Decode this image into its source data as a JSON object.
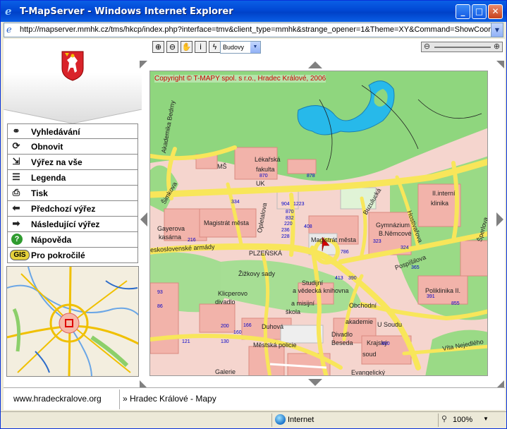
{
  "window": {
    "title": "T-MapServer - Windows Internet Explorer",
    "url": "http://mapserver.mmhk.cz/tms/hkcp/index.php?interface=tmv&client_type=mmhk&strange_opener=1&Theme=XY&Command=ShowCoor"
  },
  "sidebar": {
    "items": [
      {
        "label": "Vyhledávání",
        "icon": "binoculars-icon"
      },
      {
        "label": "Obnovit",
        "icon": "refresh-icon"
      },
      {
        "label": "Výřez na vše",
        "icon": "zoom-all-icon"
      },
      {
        "label": "Legenda",
        "icon": "legend-icon"
      },
      {
        "label": "Tisk",
        "icon": "print-icon"
      },
      {
        "label": "Předchozí výřez",
        "icon": "arrow-left-icon"
      },
      {
        "label": "Následující výřez",
        "icon": "arrow-right-icon"
      },
      {
        "label": "Nápověda",
        "icon": "help-icon"
      },
      {
        "label": "Pro pokročilé",
        "icon": "gis-icon",
        "badge": "GIS"
      }
    ]
  },
  "toolbar": {
    "layer": "Budovy"
  },
  "map": {
    "copyright": "Copyright © T-MAPY spol. s r.o., Hradec Králové, 2006",
    "labels": {
      "akademika_bedrny": "Akademika Bedrny",
      "ms": "MŠ",
      "lekarska": "Lékařská",
      "fakulta": "fakulta",
      "uk": "UK",
      "gayerova": "Gayerova",
      "kasarna": "kasárna",
      "magistrat1": "Magistrát města",
      "magistrat2": "Magistrát města",
      "plzenska": "PLZEŇSKÁ",
      "zizkovy": "Žižkovy sady",
      "studijni": "Studijní",
      "vedecka": "a vědecká knihovna",
      "klicperovo": "Klicperovo",
      "divadlo": "divadlo",
      "misijni1": "a misijní",
      "skola": "škola",
      "obchodni": "Obchodní",
      "akademie": "akademie",
      "u_soudu": "U Soudu",
      "divadlo_beseda": "Divadlo",
      "beseda": "Beseda",
      "krajsky": "Krajský",
      "soud": "soud",
      "mestska": "Městská policie",
      "galerie": "Galerie",
      "duhova": "Duhová",
      "gymnazium": "Gymnázium",
      "bnemcove": "B.Němcové",
      "pospisilova": "Pospíšilova",
      "interni1": "II.interní",
      "klinika": "klinika",
      "poliklinika": "Poliklinika II.",
      "nejedleho": "Víta Nejedlého",
      "armady": "eskoslovenské armády",
      "buzulucka": "Buzulucká",
      "hostivarova": "Hostivařova",
      "opletalova": "Opletalova",
      "pospisilova_st": "Pospíšilova",
      "zmkova": "Šimkova",
      "sperlova": "Šperlova",
      "evangelicky": "Evangelický"
    },
    "numbers": [
      "870",
      "878",
      "334",
      "904",
      "1223",
      "870",
      "832",
      "220",
      "236",
      "228",
      "216",
      "408",
      "786",
      "323",
      "324",
      "365",
      "413",
      "390",
      "391",
      "855",
      "93",
      "86",
      "200",
      "860",
      "121",
      "130",
      "160",
      "166"
    ]
  },
  "footer": {
    "site": "www.hradeckralove.org",
    "breadcrumb": "» Hradec Králové - Mapy"
  },
  "status": {
    "zone": "Internet",
    "zoom": "100%"
  }
}
